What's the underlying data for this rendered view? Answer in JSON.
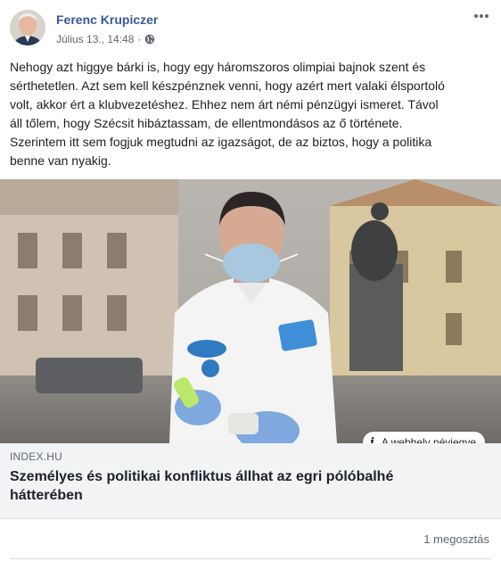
{
  "post": {
    "author": "Ferenc Krupiczer",
    "timestamp": "Július 13., 14:48",
    "separator": "·",
    "privacy_icon": "globe-icon",
    "more_icon": "more-options-icon",
    "text_lines": [
      "Nehogy azt higgye bárki is, hogy egy háromszoros olimpiai bajnok szent és",
      "sérthetetlen. Azt sem kell készpénznek venni, hogy azért mert valaki élsportoló",
      "volt, akkor ért a klubvezetéshez. Ehhez nem árt némi pénzügyi ismeret. Távol",
      "áll tőlem, hogy Szécsit hibáztassam, de ellentmondásos az ő története.",
      "Szerintem itt sem fogjuk megtudni az igazságot, de az biztos, hogy a politika",
      "benne van nyakig."
    ]
  },
  "link": {
    "about_label": "A webhely névjegye",
    "about_icon": "info-icon",
    "domain": "INDEX.HU",
    "title_lines": [
      "Személyes és politikai konfliktus állhat az egri pólóbalhé",
      "hátterében"
    ]
  },
  "footer": {
    "shares": "1 megosztás"
  },
  "colors": {
    "author_link": "#385898",
    "meta_gray": "#606770",
    "link_box_bg": "#f2f3f5"
  }
}
